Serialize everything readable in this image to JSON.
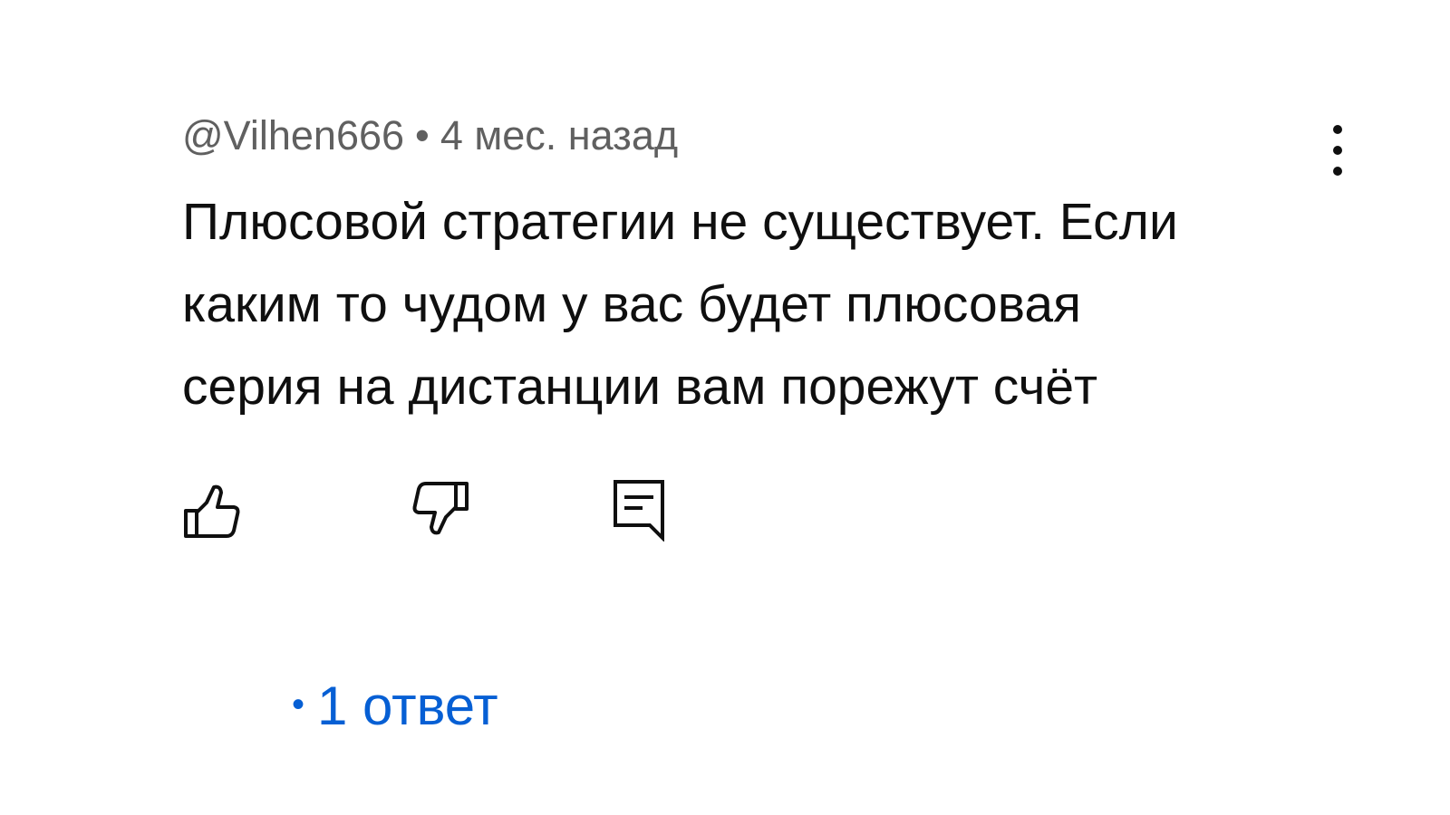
{
  "comment": {
    "author": "@Vilhen666",
    "separator": "•",
    "time": "4 мес. назад",
    "lines": [
      "Плюсовой стратегии не существует. Если",
      "каким то чудом у вас будет плюсовая",
      "серия на дистанции вам порежут счёт"
    ],
    "actions": {
      "like_icon": "thumbs-up-icon",
      "dislike_icon": "thumbs-down-icon",
      "reply_icon": "comment-reply-icon"
    },
    "more_icon": "more-vertical-icon",
    "replies": {
      "bullet": "•",
      "label": "1 ответ"
    }
  },
  "colors": {
    "text": "#0f0f0f",
    "meta": "#606060",
    "link": "#065fd4",
    "background": "#ffffff"
  }
}
